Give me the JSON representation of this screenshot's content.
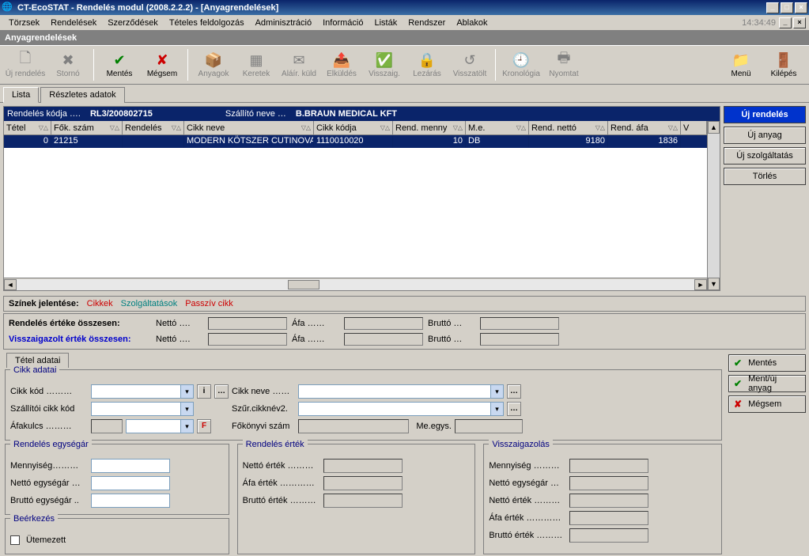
{
  "window": {
    "title": "CT-EcoSTAT - Rendelés modul (2008.2.2.2) - [Anyagrendelések]"
  },
  "menubar": {
    "items": [
      "Törzsek",
      "Rendelések",
      "Szerződések",
      "Tételes feldolgozás",
      "Adminisztráció",
      "Információ",
      "Listák",
      "Rendszer",
      "Ablakok"
    ],
    "clock": "14:34:49"
  },
  "subtitle": "Anyagrendelések",
  "toolbar": {
    "uj_rendeles": "Új rendelés",
    "storno": "Stornó",
    "mentes": "Mentés",
    "megsem": "Mégsem",
    "anyagok": "Anyagok",
    "keretek": "Keretek",
    "alair": "Aláír. küld",
    "elkuldes": "Elküldés",
    "visszaig": "Visszaig.",
    "lezaras": "Lezárás",
    "visszatolt": "Visszatölt",
    "kronologia": "Kronológia",
    "nyomtat": "Nyomtat",
    "menu": "Menü",
    "kilepes": "Kilépés"
  },
  "tabs": {
    "lista": "Lista",
    "reszletes": "Részletes adatok"
  },
  "order_header": {
    "code_label": "Rendelés kódja ….",
    "code_value": "RL3/200802715",
    "supplier_label": "Szállító neve …",
    "supplier_value": "B.BRAUN MEDICAL KFT"
  },
  "grid": {
    "columns": [
      "Tétel",
      "Fők. szám",
      "Rendelés",
      "Cikk neve",
      "Cikk kódja",
      "Rend. menny",
      "M.e.",
      "Rend. nettó",
      "Rend. áfa",
      "V"
    ],
    "rows": [
      {
        "tetel": "0",
        "fokszam": "21215",
        "rendeles": "",
        "cikknev": "MODERN KÖTSZER CUTINOVA",
        "cikkkod": "1110010020",
        "menny": "10",
        "me": "DB",
        "netto": "9180",
        "afa": "1836",
        "v": ""
      }
    ]
  },
  "sidebuttons": {
    "uj_rendeles": "Új rendelés",
    "uj_anyag": "Új anyag",
    "uj_szolg": "Új szolgáltatás",
    "torles": "Törlés"
  },
  "legend": {
    "title": "Színek jelentése:",
    "cikkek": "Cikkek",
    "szolg": "Szolgáltatások",
    "passziv": "Passzív cikk"
  },
  "sums": {
    "order_title": "Rendelés értéke összesen:",
    "confirm_title": "Visszaigazolt érték összesen:",
    "netto": "Nettó ….",
    "afa": "Áfa ……",
    "brutto": "Bruttó …"
  },
  "detail_tab": "Tétel adatai",
  "cikk": {
    "legend": "Cikk adatai",
    "kod": "Cikk kód ………",
    "szallito_kod": "Szállítói cikk kód",
    "afakulcs": "Áfakulcs ………",
    "nev": "Cikk neve ……",
    "szur": "Szűr.cikknév2.",
    "fokonyvi": "Főkönyvi szám",
    "meegys": "Me.egys."
  },
  "rend_egysegar": {
    "legend": "Rendelés egységár",
    "menny": "Mennyiség………",
    "netto_e": "Nettó egységár …",
    "brutto_e": "Bruttó egységár .."
  },
  "rend_ertek": {
    "legend": "Rendelés érték",
    "netto": "Nettó érték ………",
    "afa": "Áfa érték …………",
    "brutto": "Bruttó érték ………"
  },
  "visszaig": {
    "legend": "Visszaigazolás",
    "menny": "Mennyiség ………",
    "netto_e": "Nettó egységár …",
    "netto": "Nettó érték ………",
    "afa": "Áfa érték …………",
    "brutto": "Bruttó érték ………"
  },
  "beerkezes": {
    "legend": "Beérkezés",
    "utemezett": "Ütemezett"
  },
  "actions": {
    "mentes": "Mentés",
    "ment_uj": "Ment/új anyag",
    "megsem": "Mégsem"
  }
}
